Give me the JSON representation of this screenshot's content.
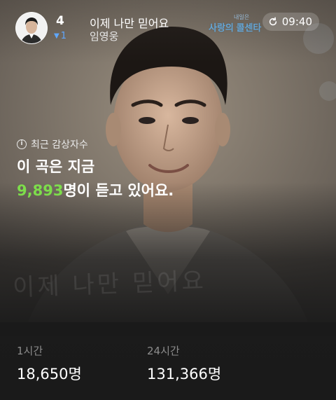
{
  "header": {
    "rank": "4",
    "song_title": "이제 나만 믿어요",
    "rank_change": "1",
    "rank_change_direction": "down",
    "artist": "임영웅",
    "channel_logo_text": "사랑의 콜센타",
    "time": "09:40"
  },
  "listeners": {
    "info_label": "최근 감상자수",
    "headline_line1": "이 곡은 지금",
    "count": "9,893",
    "headline_suffix": "명이 듣고 있어요."
  },
  "background_text": "이제 나만 믿어요",
  "stats": [
    {
      "label": "1시간",
      "value": "18,650명"
    },
    {
      "label": "24시간",
      "value": "131,366명"
    }
  ],
  "colors": {
    "accent_green": "#7ddd4b",
    "rank_down_blue": "#5fa7ff",
    "background": "#1a1a1a"
  },
  "icons": {
    "info": "info-circle-icon",
    "refresh": "refresh-icon",
    "rank_change": "triangle-down-icon"
  }
}
